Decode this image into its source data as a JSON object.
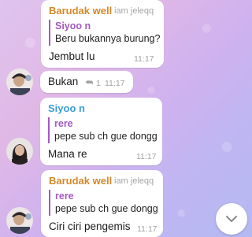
{
  "messages": [
    {
      "sender": "Barudak well",
      "role": "iam jeleqq",
      "reply": {
        "name": "Siyoo n",
        "text": "Beru bukannya burung?"
      },
      "text": "Jembut lu",
      "time": "11:17"
    },
    {
      "text": "Bukan",
      "reply_count": "1",
      "time": "11:17"
    },
    {
      "sender": "Siyoo n",
      "reply": {
        "name": "rere",
        "text": "pepe sub ch gue dongg"
      },
      "text": "Mana re",
      "time": "11:17"
    },
    {
      "sender": "Barudak well",
      "role": "iam jeleqq",
      "reply": {
        "name": "rere",
        "text": "pepe sub ch gue dongg"
      },
      "text": "Ciri ciri pengemis",
      "time": "11:17"
    }
  ],
  "icons": {
    "reply": "reply-arrow-icon",
    "scroll_down": "chevron-down-icon"
  },
  "colors": {
    "sender_barudak": "#d3892a",
    "sender_siyoo": "#3a9ed6",
    "reply_accent": "#a35ac2"
  }
}
